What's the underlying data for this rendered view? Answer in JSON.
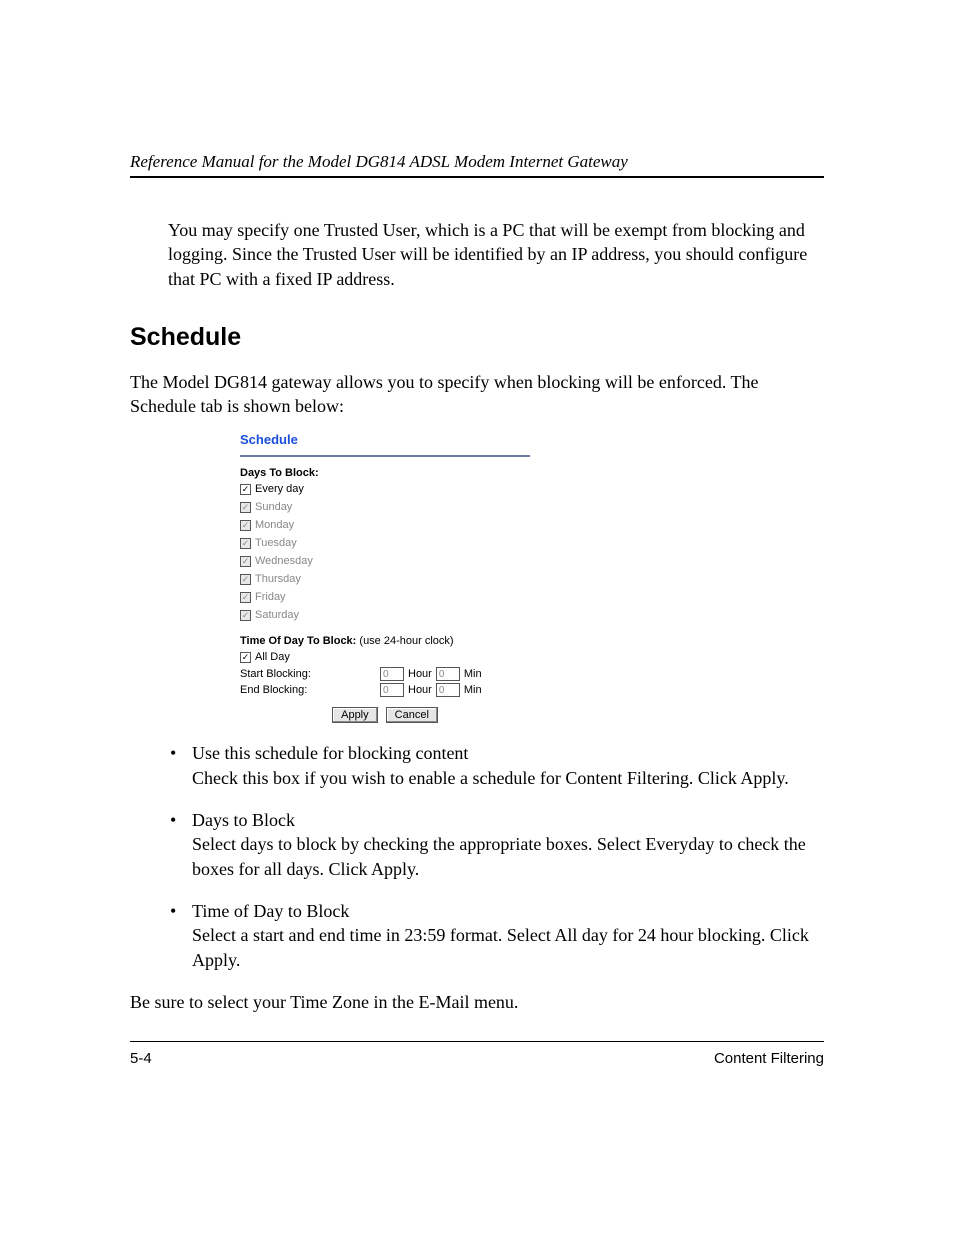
{
  "header": {
    "running_head": "Reference Manual for the Model DG814 ADSL Modem Internet Gateway"
  },
  "intro": "You may specify one Trusted User, which is a PC that will be exempt from blocking and logging. Since the Trusted User will be identified by an IP address, you should configure that PC with a fixed IP address.",
  "section_title": "Schedule",
  "section_intro": "The Model DG814 gateway allows you to specify when blocking will be enforced. The Schedule tab is shown below:",
  "panel": {
    "title": "Schedule",
    "days_label": "Days To Block:",
    "days": [
      {
        "label": "Every day",
        "checked": true,
        "enabled": true
      },
      {
        "label": "Sunday",
        "checked": true,
        "enabled": false
      },
      {
        "label": "Monday",
        "checked": true,
        "enabled": false
      },
      {
        "label": "Tuesday",
        "checked": true,
        "enabled": false
      },
      {
        "label": "Wednesday",
        "checked": true,
        "enabled": false
      },
      {
        "label": "Thursday",
        "checked": true,
        "enabled": false
      },
      {
        "label": "Friday",
        "checked": true,
        "enabled": false
      },
      {
        "label": "Saturday",
        "checked": true,
        "enabled": false
      }
    ],
    "time_label": "Time Of Day To Block:",
    "time_hint": "(use 24-hour clock)",
    "all_day_label": "All Day",
    "start_label": "Start Blocking:",
    "end_label": "End Blocking:",
    "hour_label": "Hour",
    "min_label": "Min",
    "start_hour": "0",
    "start_min": "0",
    "end_hour": "0",
    "end_min": "0",
    "apply_label": "Apply",
    "cancel_label": "Cancel"
  },
  "bullets": [
    {
      "head": "Use this schedule for blocking content",
      "body": "Check this box if you wish to enable a schedule for Content Filtering. Click Apply."
    },
    {
      "head": "Days to Block",
      "body": "Select days to block by checking the appropriate boxes. Select Everyday to check the boxes for all days. Click Apply."
    },
    {
      "head": "Time of Day to Block",
      "body": "Select a start and end time in 23:59 format. Select All day for 24 hour blocking. Click Apply."
    }
  ],
  "closing": "Be sure to select your Time Zone in the E-Mail menu.",
  "footer": {
    "page_number": "5-4",
    "section": "Content Filtering"
  }
}
